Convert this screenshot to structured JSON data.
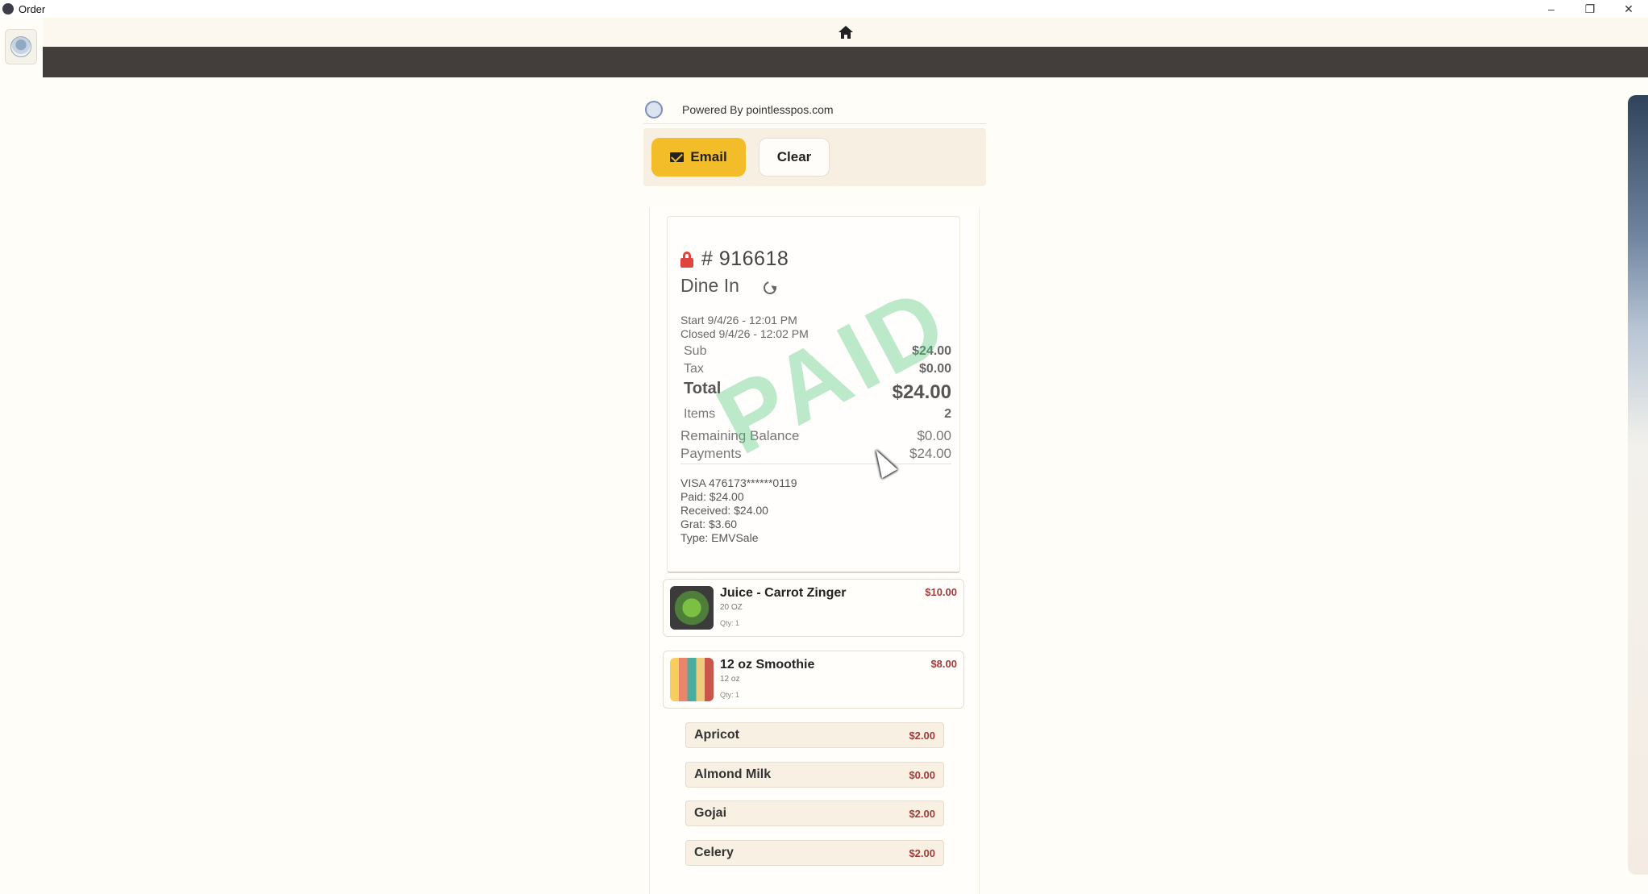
{
  "window": {
    "title": "Order",
    "controls": [
      "–",
      "❐",
      "✕"
    ]
  },
  "powered_by": "Powered By pointlesspos.com",
  "actions": {
    "email_label": "Email",
    "clear_label": "Clear"
  },
  "order": {
    "number": "# 916618",
    "type": "Dine In",
    "start": "Start 9/4/26 - 12:01 PM",
    "closed": "Closed 9/4/26 - 12:02 PM",
    "sub_label": "Sub",
    "sub_value": "$24.00",
    "tax_label": "Tax",
    "tax_value": "$0.00",
    "total_label": "Total",
    "total_value": "$24.00",
    "items_label": "Items",
    "items_value": "2",
    "remaining_label": "Remaining Balance",
    "remaining_value": "$0.00",
    "payments_label": "Payments",
    "payments_value": "$24.00",
    "stamp": "PAID",
    "payment": {
      "card": "VISA 476173******0119",
      "paid": "Paid: $24.00",
      "received": "Received: $24.00",
      "grat": "Grat: $3.60",
      "type": "Type: EMVSale"
    }
  },
  "items": [
    {
      "name": "Juice - Carrot Zinger",
      "size": "20 OZ",
      "qty": "Qty: 1",
      "price": "$10.00"
    },
    {
      "name": "12 oz Smoothie",
      "size": "12 oz",
      "qty": "Qty: 1",
      "price": "$8.00"
    }
  ],
  "modifiers": [
    {
      "name": "Apricot",
      "price": "$2.00"
    },
    {
      "name": "Almond Milk",
      "price": "$0.00"
    },
    {
      "name": "Gojai",
      "price": "$2.00"
    },
    {
      "name": "Celery",
      "price": "$2.00"
    }
  ],
  "colors": {
    "accent": "#f3bd2a",
    "header_bar": "#433e3b",
    "price": "#a33b3b",
    "lock": "#e0443e",
    "paid_stamp": "#50c878"
  }
}
